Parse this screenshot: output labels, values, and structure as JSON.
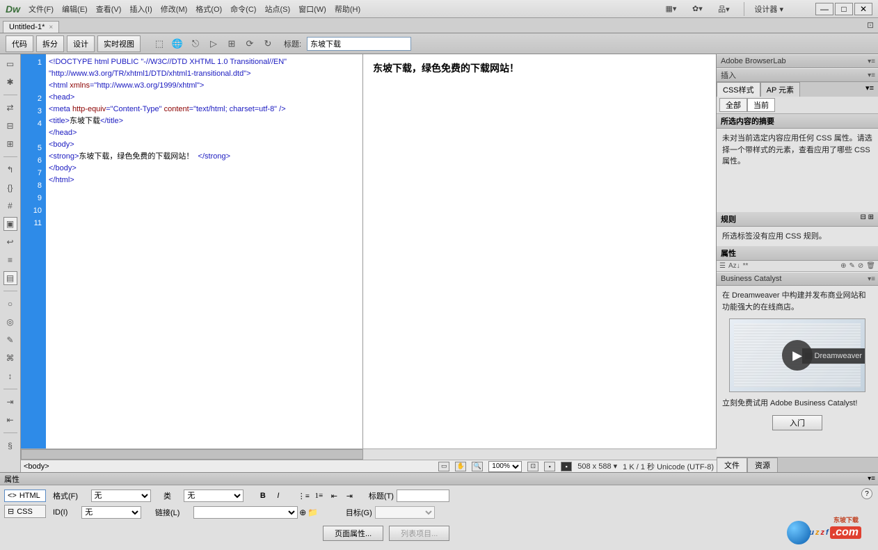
{
  "app": {
    "logo": "Dw",
    "designer": "设计器 ▾"
  },
  "menus": [
    "文件(F)",
    "编辑(E)",
    "查看(V)",
    "插入(I)",
    "修改(M)",
    "格式(O)",
    "命令(C)",
    "站点(S)",
    "窗口(W)",
    "帮助(H)"
  ],
  "tab": {
    "name": "Untitled-1*"
  },
  "toolbar": {
    "code": "代码",
    "split": "拆分",
    "design": "设计",
    "live": "实时视图",
    "title_label": "标题:",
    "title_value": "东坡下载"
  },
  "code": {
    "lines": [
      "1",
      "2",
      "3",
      "4",
      "5",
      "6",
      "7",
      "8",
      "9",
      "10",
      "11"
    ],
    "l1a": "<!DOCTYPE html PUBLIC ",
    "l1b": "\"-//W3C//DTD XHTML 1.0 Transitional//EN\"",
    "l1c": "\"http://www.w3.org/TR/xhtml1/DTD/xhtml1-transitional.dtd\"",
    "l1d": ">",
    "l2a": "<html ",
    "l2b": "xmlns",
    "l2c": "=\"http://www.w3.org/1999/xhtml\"",
    "l2d": ">",
    "l3": "<head>",
    "l4a": "<meta ",
    "l4b": "http-equiv",
    "l4c": "=\"Content-Type\" ",
    "l4d": "content",
    "l4e": "=\"text/html; charset=utf-8\" ",
    "l4f": "/>",
    "l5a": "<title>",
    "l5b": "东坡下载",
    "l5c": "</title>",
    "l6": "</head>",
    "l7": "<body>",
    "l8a": "<strong>",
    "l8b": "东坡下载，绿色免费的下载网站！  ",
    "l8c": "</strong>",
    "l9": "</body>",
    "l10": "</html>"
  },
  "preview": {
    "text": "东坡下载，绿色免费的下载网站！"
  },
  "tagsel": {
    "body": "<body>"
  },
  "status": {
    "zoom": "100%",
    "dim": "508 x 588 ▾",
    "size": "1 K / 1 秒 Unicode (UTF-8)"
  },
  "panels": {
    "browserlab": "Adobe BrowserLab",
    "insert": "插入",
    "css_tab": "CSS样式",
    "ap_tab": "AP 元素",
    "all": "全部",
    "current": "当前",
    "summary_header": "所选内容的摘要",
    "summary_text": "未对当前选定内容应用任何 CSS 属性。请选择一个带样式的元素，查看应用了哪些 CSS 属性。",
    "rules_header": "规则",
    "rules_text": "所选标签没有应用 CSS 规则。",
    "attrs_header": "属性",
    "az": "Aᴢ↓",
    "bc_header": "Business Catalyst",
    "bc_text": "在 Dreamweaver 中构建并发布商业网站和功能强大的在线商店。",
    "bc_video": "Dreamweaver",
    "bc_cta": "立刻免费试用 Adobe Business Catalyst!",
    "bc_btn": "入门",
    "files": "文件",
    "assets": "资源"
  },
  "props": {
    "header": "属性",
    "html": "HTML",
    "css": "CSS",
    "format": "格式(F)",
    "class": "类",
    "id": "ID(I)",
    "link": "链接(L)",
    "title": "标题(T)",
    "target": "目标(G)",
    "none": "无",
    "page_props": "页面属性...",
    "list_item": "列表项目..."
  },
  "watermark": {
    "cn": "东坡下载"
  }
}
